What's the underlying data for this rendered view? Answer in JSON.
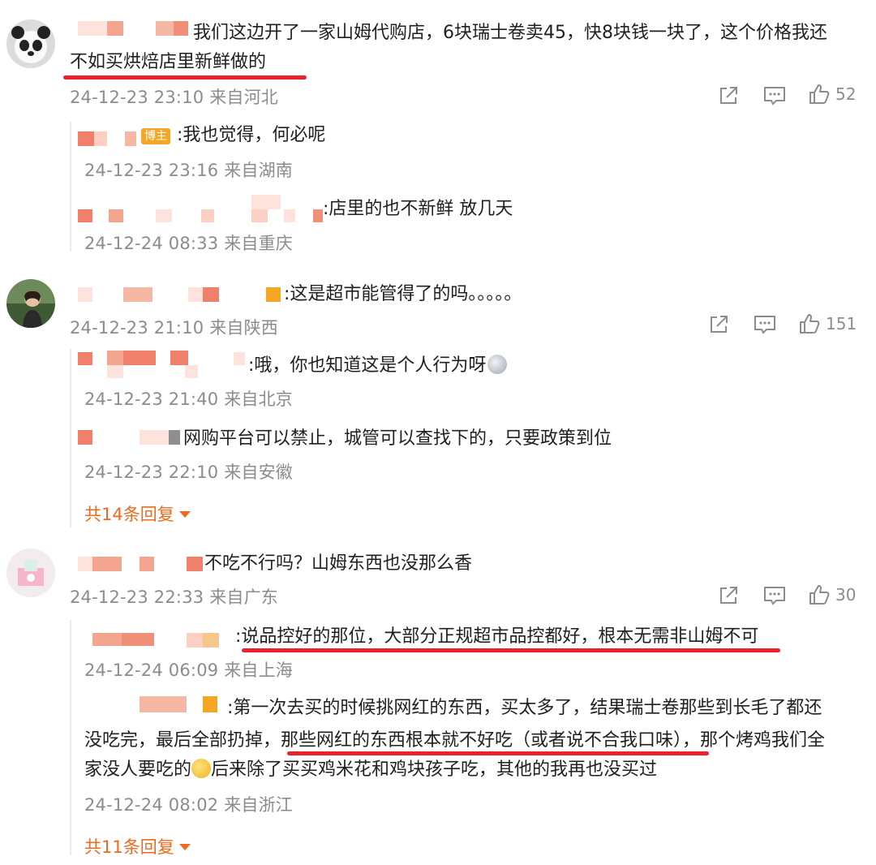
{
  "comments": [
    {
      "text": "我们这边开了一家山姆代购店，6块瑞士卷卖45，快8块钱一块了，这个价格我还不如买烘焙店里新鲜做的",
      "line1": "我们这边开了一家山姆代购店，6块瑞士卷卖45，快8块钱一块了，这个价格我还",
      "line2": "不如买烘焙店里新鲜做的",
      "meta": "24-12-23 23:10 来自河北",
      "like_count": "52",
      "replies": [
        {
          "author_badge": "博主",
          "text": ":我也觉得，何必呢",
          "meta": "24-12-23 23:16 来自湖南"
        },
        {
          "text": ":店里的也不新鲜  放几天",
          "meta": "24-12-24 08:33 来自重庆"
        }
      ]
    },
    {
      "text": ":这是超市能管得了的吗。。。。。",
      "meta": "24-12-23 21:10 来自陕西",
      "like_count": "151",
      "replies": [
        {
          "text": ":哦，你也知道这是个人行为呀",
          "meta": "24-12-23 21:40 来自北京"
        },
        {
          "text": "网购平台可以禁止，城管可以查找下的，只要政策到位",
          "meta": "24-12-23 22:10 来自安徽"
        }
      ],
      "more_replies": "共14条回复"
    },
    {
      "text": "不吃不行吗？山姆东西也没那么香",
      "meta": "24-12-23 22:33 来自广东",
      "like_count": "30",
      "replies": [
        {
          "text": ":说品控好的那位，大部分正规超市品控都好，根本无需非山姆不可",
          "meta": "24-12-24 06:09 来自上海"
        },
        {
          "line1": ":第一次去买的时候挑网红的东西，买太多了，结果瑞士卷那些到长毛了都还",
          "line2": "没吃完，最后全部扔掉，那些网红的东西根本就不好吃（或者说不合我口味），那个烤鸡我们全",
          "line3a": "家没人要吃的",
          "line3b": "后来除了买买鸡米花和鸡块孩子吃，其他的我再也没买过",
          "meta": "24-12-24 08:02 来自浙江"
        }
      ],
      "more_replies": "共11条回复"
    }
  ],
  "icons": {
    "share": "share-icon",
    "comment": "comment-icon",
    "like": "thumbs-up-icon"
  },
  "colors": {
    "accent": "#f06a1d",
    "highlight": "#e8232a",
    "meta": "#8c8c8c"
  }
}
